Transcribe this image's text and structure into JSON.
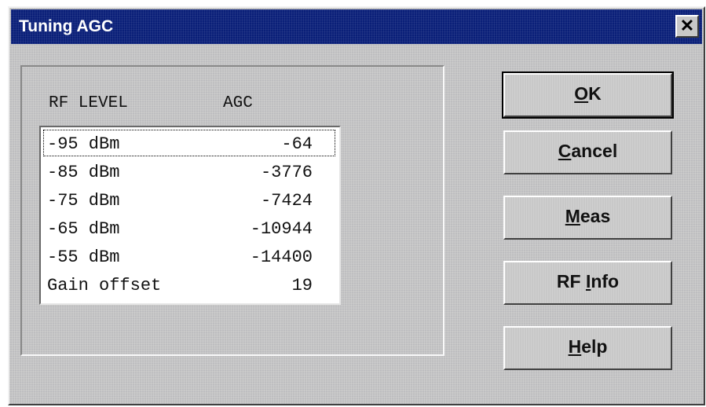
{
  "window": {
    "title": "Tuning AGC",
    "close_glyph": "✕"
  },
  "table": {
    "headers": {
      "rf": "RF LEVEL",
      "agc": "AGC"
    },
    "rows": [
      {
        "rf": "-95 dBm",
        "agc": "-64"
      },
      {
        "rf": "-85 dBm",
        "agc": "-3776"
      },
      {
        "rf": "-75 dBm",
        "agc": "-7424"
      },
      {
        "rf": "-65 dBm",
        "agc": "-10944"
      },
      {
        "rf": "-55 dBm",
        "agc": "-14400"
      },
      {
        "rf": "Gain offset",
        "agc": "19"
      }
    ]
  },
  "buttons": {
    "ok": {
      "mnemonic": "O",
      "rest": "K"
    },
    "cancel": {
      "mnemonic": "C",
      "rest": "ancel"
    },
    "meas": {
      "mnemonic": "M",
      "rest": "eas"
    },
    "rfinfo": {
      "pre": "RF ",
      "mnemonic": "I",
      "rest": "nfo"
    },
    "help": {
      "mnemonic": "H",
      "rest": "elp"
    }
  }
}
